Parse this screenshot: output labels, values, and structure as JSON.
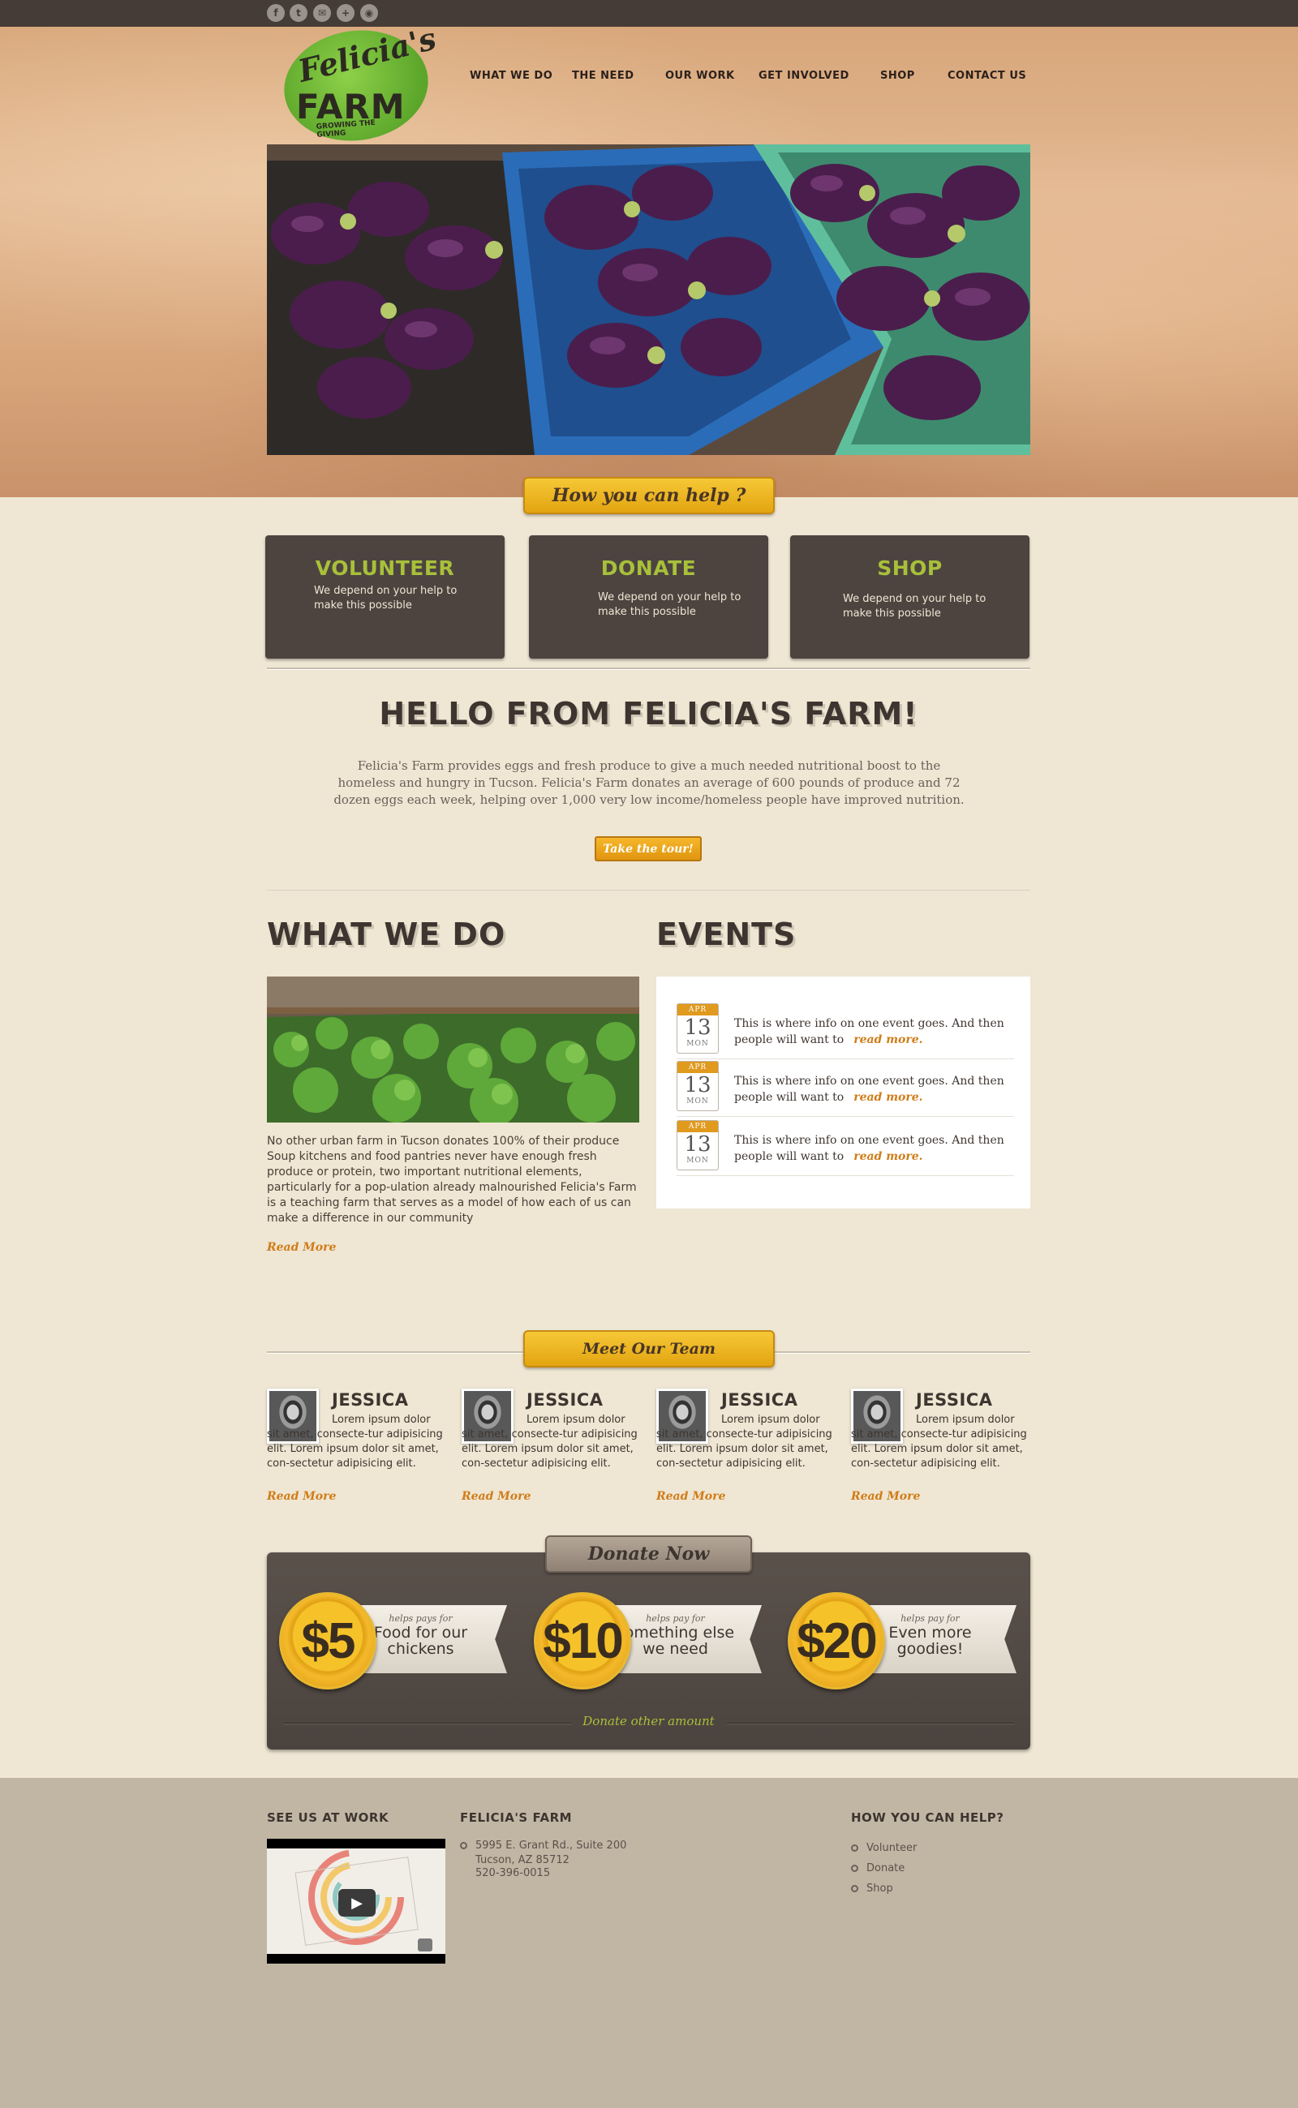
{
  "social": [
    "facebook-icon",
    "twitter-icon",
    "email-icon",
    "plus-icon",
    "rss-icon"
  ],
  "logo": {
    "script": "Felicia's",
    "word": "FARM",
    "tagline": "GROWING THE GIVING"
  },
  "nav": [
    "WHAT WE DO",
    "THE NEED",
    "OUR WORK",
    "GET INVOLVED",
    "SHOP",
    "CONTACT US"
  ],
  "help": {
    "ribbon": "How you can help ?",
    "boxes": [
      {
        "title": "VOLUNTEER",
        "text": "We depend on your help to make this possible"
      },
      {
        "title": "DONATE",
        "text": "We depend on your help to make this possible"
      },
      {
        "title": "SHOP",
        "text": "We depend on your help to make this possible"
      }
    ]
  },
  "hello": {
    "title": "HELLO FROM FELICIA'S FARM!",
    "body": "Felicia's Farm provides eggs and fresh produce to give a much needed nutritional boost to the homeless and hungry in Tucson. Felicia's Farm donates an average of 600 pounds of produce and 72 dozen eggs each week, helping over 1,000 very low income/homeless people have improved nutrition.",
    "button": "Take the tour!"
  },
  "what_we_do": {
    "title": "WHAT WE DO",
    "body": "No other urban farm in Tucson donates 100% of their produce Soup kitchens and food pantries never have enough fresh produce or protein, two important nutritional elements, particularly for a pop-ulation already malnourished Felicia's Farm is a teaching farm that serves as a model of how each of us can make a difference in our community",
    "read_more": "Read More"
  },
  "events": {
    "title": "EVENTS",
    "items": [
      {
        "month": "APR",
        "day": "13",
        "weekday": "MON",
        "text": "This is where info on one event goes. And then people will want to",
        "link": "read more."
      },
      {
        "month": "APR",
        "day": "13",
        "weekday": "MON",
        "text": "This is where info on one event goes. And then people will want to",
        "link": "read more."
      },
      {
        "month": "APR",
        "day": "13",
        "weekday": "MON",
        "text": "This is where info on one event goes. And then people will want to",
        "link": "read more."
      }
    ]
  },
  "team": {
    "ribbon": "Meet Our Team",
    "members": [
      {
        "name": "JESSICA",
        "bio": "Lorem ipsum dolor sit amet, consecte-tur adipisicing elit. Lorem ipsum dolor sit amet, con-sectetur adipisicing elit.",
        "read_more": "Read More"
      },
      {
        "name": "JESSICA",
        "bio": "Lorem ipsum dolor sit amet, consecte-tur adipisicing elit. Lorem ipsum dolor sit amet, con-sectetur adipisicing elit.",
        "read_more": "Read More"
      },
      {
        "name": "JESSICA",
        "bio": "Lorem ipsum dolor sit amet, consecte-tur adipisicing elit. Lorem ipsum dolor sit amet, con-sectetur adipisicing elit.",
        "read_more": "Read More"
      },
      {
        "name": "JESSICA",
        "bio": "Lorem ipsum dolor sit amet, consecte-tur adipisicing elit. Lorem ipsum dolor sit amet, con-sectetur adipisicing elit.",
        "read_more": "Read More"
      }
    ]
  },
  "donate": {
    "ribbon": "Donate Now",
    "options": [
      {
        "amount": "$5",
        "small": "helps pays for",
        "big": "Food for our chickens"
      },
      {
        "amount": "$10",
        "small": "helps pay for",
        "big": "something else we need"
      },
      {
        "amount": "$20",
        "small": "helps pay for",
        "big": "Even more goodies!"
      }
    ],
    "other": "Donate other amount"
  },
  "footer": {
    "video_title": "SEE US AT WORK",
    "farm_title": "FELICIA'S FARM",
    "address": [
      "5995 E. Grant Rd., Suite 200",
      "Tucson, AZ 85712",
      "520-396-0015"
    ],
    "help_title": "HOW YOU CAN HELP?",
    "help_links": [
      "Volunteer",
      "Donate",
      "Shop"
    ]
  },
  "colors": {
    "dark": "#463c37",
    "accent": "#e3a411",
    "green": "#a8c03a",
    "orange_link": "#d07c18",
    "cream": "#efe6d3"
  }
}
